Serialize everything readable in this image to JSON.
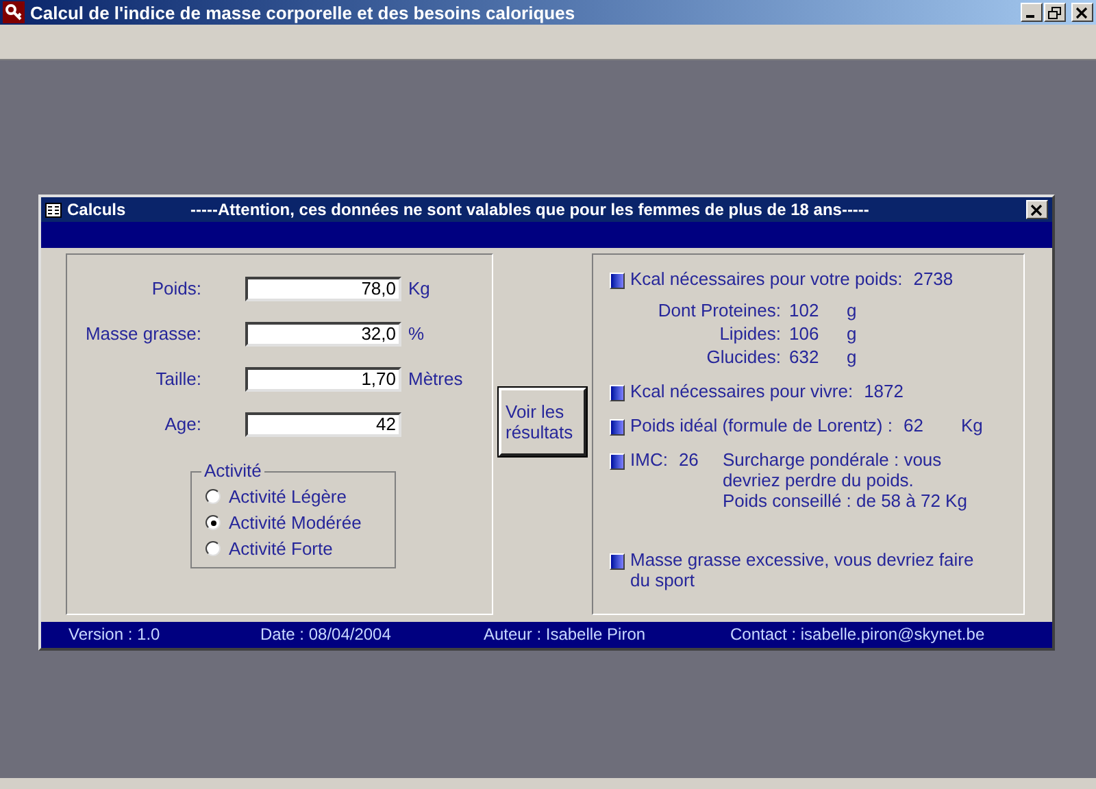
{
  "window": {
    "title": "Calcul de l'indice de masse corporelle et des besoins caloriques"
  },
  "form": {
    "title": "Calculs",
    "warning": "-----Attention, ces données ne sont valables que pour les femmes de plus de 18 ans-----",
    "fields": [
      {
        "label": "Poids:",
        "value": "78,0",
        "unit": "Kg"
      },
      {
        "label": "Masse grasse:",
        "value": "32,0",
        "unit": "%"
      },
      {
        "label": "Taille:",
        "value": "1,70",
        "unit": "Mètres"
      },
      {
        "label": "Age:",
        "value": "42"
      }
    ],
    "activity": {
      "legend": "Activité",
      "options": [
        {
          "label": "Activité Légère",
          "selected": false
        },
        {
          "label": "Activité Modérée",
          "selected": true
        },
        {
          "label": "Activité Forte",
          "selected": false
        }
      ]
    },
    "button": "Voir les résultats",
    "results": [
      {
        "label": "Kcal nécessaires pour votre poids:",
        "value": "2738",
        "breakdown": [
          {
            "label": "Dont Proteines:",
            "value": "102",
            "unit": "g"
          },
          {
            "label": "Lipides:",
            "value": "106",
            "unit": "g"
          },
          {
            "label": "Glucides:",
            "value": "632",
            "unit": "g"
          }
        ]
      },
      {
        "label": "Kcal nécessaires pour vivre:",
        "value": "1872"
      },
      {
        "label": "Poids idéal (formule de Lorentz) :",
        "value": "62",
        "unit": "Kg"
      },
      {
        "label": "IMC:",
        "value": "26",
        "lines": [
          "Surcharge pondérale : vous devriez perdre du poids.",
          "Poids conseillé : de 58 à 72 Kg"
        ]
      },
      {
        "lines": [
          "Masse grasse excessive, vous devriez faire du sport"
        ]
      }
    ],
    "footer": [
      "Version : 1.0",
      "Date : 08/04/2004",
      "Auteur : Isabelle Piron",
      "Contact : isabelle.piron@skynet.be"
    ]
  }
}
